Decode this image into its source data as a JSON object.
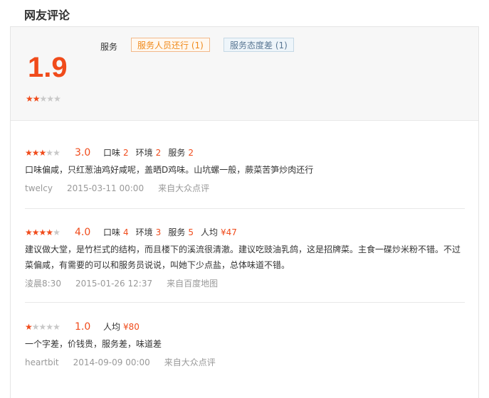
{
  "title": "网友评论",
  "summary": {
    "score": "1.9",
    "stars": 2,
    "category": "服务",
    "tags": [
      {
        "label": "服务人员还行 (1)",
        "sentiment": "positive"
      },
      {
        "label": "服务态度差 (1)",
        "sentiment": "negative"
      }
    ]
  },
  "reviews": [
    {
      "stars": 3,
      "score": "3.0",
      "dims": [
        {
          "label": "口味",
          "value": "2"
        },
        {
          "label": "环境",
          "value": "2"
        },
        {
          "label": "服务",
          "value": "2"
        }
      ],
      "text": "口味偏咸，只红葱油鸡好咸呢，盖晒D鸡味。山坑螺一般，蕨菜苦笋炒肉还行",
      "user": "twelcy",
      "date": "2015-03-11 00:00",
      "source": "来自大众点评"
    },
    {
      "stars": 4,
      "score": "4.0",
      "dims": [
        {
          "label": "口味",
          "value": "4"
        },
        {
          "label": "环境",
          "value": "3"
        },
        {
          "label": "服务",
          "value": "5"
        },
        {
          "label": "人均",
          "value": "¥47"
        }
      ],
      "text": "建议做大堂，是竹栏式的结构，而且楼下的溪流很清澈。建议吃豉油乳鸽，这是招牌菜。主食一碟炒米粉不错。不过菜偏咸，有需要的可以和服务员说说，叫她下少点盐，总体味道不错。",
      "user": "淩晨8:30",
      "date": "2015-01-26 12:37",
      "source": "来自百度地图"
    },
    {
      "stars": 1,
      "score": "1.0",
      "dims": [
        {
          "label": "人均",
          "value": "¥80"
        }
      ],
      "text": "一个字差，价钱贵，服务差，味道差",
      "user": "heartbit",
      "date": "2014-09-09 00:00",
      "source": "来自大众点评"
    }
  ],
  "colors": {
    "accent": "#f04b1b",
    "star_off": "#c8c8c8"
  }
}
